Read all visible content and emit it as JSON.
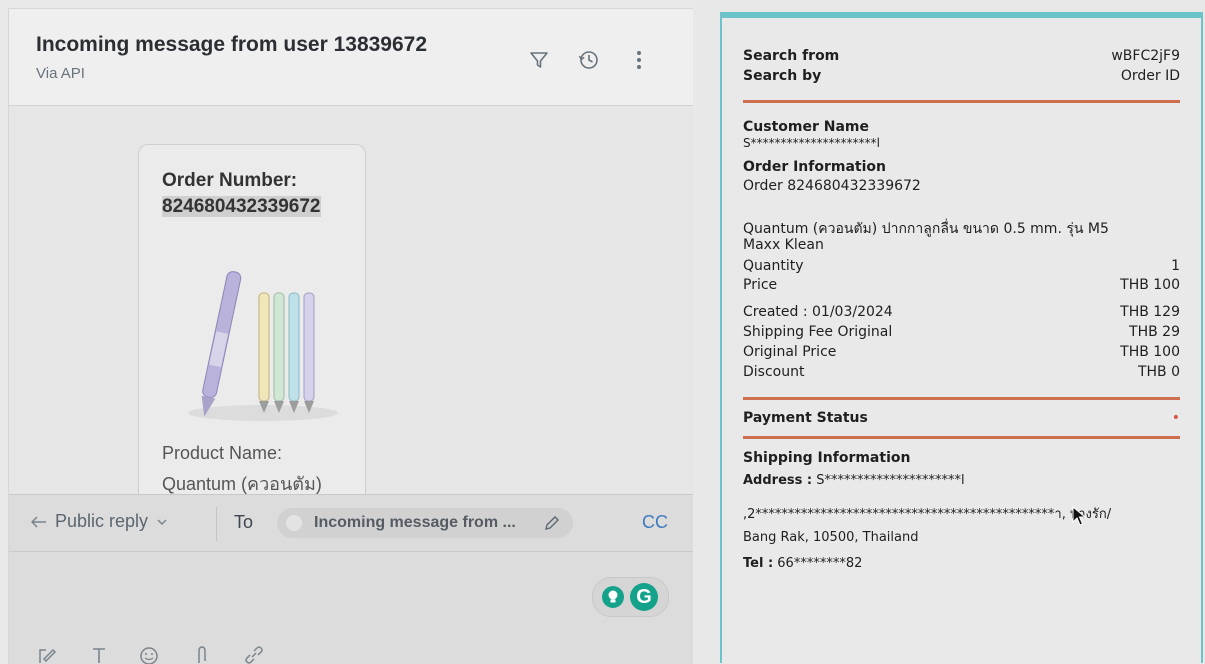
{
  "ticket": {
    "title": "Incoming message from user 13839672",
    "channel": "Via API",
    "header_icons": [
      "filter-icon",
      "history-icon",
      "more-icon"
    ]
  },
  "order_card": {
    "order_label": "Order Number:",
    "order_number": "824680432339672",
    "product_label": "Product Name:",
    "product_value": "Quantum (ควอนตัม)"
  },
  "composer": {
    "reply_type": "Public reply",
    "to_label": "To",
    "recipient": "Incoming message from ...",
    "cc_label": "CC",
    "grammarly_letter": "G",
    "toolbar_icons": [
      "compose-format-icon",
      "text-icon",
      "emoji-icon",
      "attachment-icon",
      "link-icon"
    ]
  },
  "app_panel": {
    "search_from_label": "Search from",
    "search_from_value": "wBFC2jF9",
    "search_by_label": "Search by",
    "search_by_value": "Order ID",
    "customer_name_label": "Customer Name",
    "customer_name_value": "S*********************l",
    "order_info_label": "Order Information",
    "order_line": "Order 824680432339672",
    "product_line1": "Quantum (ควอนตัม) ปากกาลูกลื่น ขนาด 0.5 mm. รุ่น M5",
    "product_line2": "Maxx Klean",
    "quantity_label": "Quantity",
    "quantity_value": "1",
    "price_label": "Price",
    "price_value": "THB 100",
    "created_label": "Created : 01/03/2024",
    "created_value": "THB 129",
    "shipping_fee_label": "Shipping Fee Original",
    "shipping_fee_value": "THB 29",
    "original_price_label": "Original Price",
    "original_price_value": "THB 100",
    "discount_label": "Discount",
    "discount_value": "THB 0",
    "payment_status_label": "Payment Status",
    "payment_status_value": "•",
    "shipping_info_label": "Shipping Information",
    "address_label": "Address :",
    "address_name": "S*********************l",
    "address_line1": ",2*******************************************",
    "address_line1_tail": "***า, บางรัก/",
    "address_line2": "Bang Rak, 10500, Thailand",
    "tel_label": "Tel :",
    "tel_value": "66********82"
  },
  "colors": {
    "accent_teal": "#6cc3c9",
    "divider_orange": "#cf6f50",
    "grammarly_green": "#15a28a",
    "cc_blue": "#3d7bbf"
  }
}
